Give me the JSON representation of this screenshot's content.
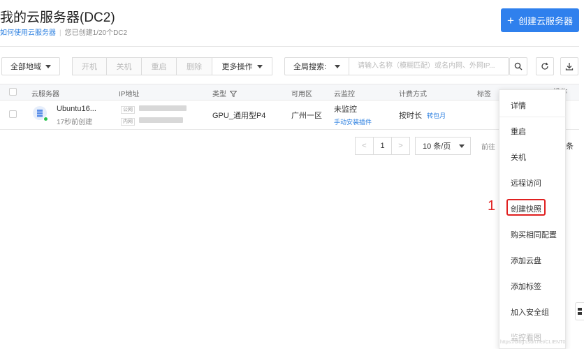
{
  "header": {
    "title": "我的云服务器(DC2)",
    "help_link": "如何使用云服务器",
    "quota_text": "您已创建1/20个DC2",
    "create_button": "创建云服务器"
  },
  "toolbar": {
    "region": "全部地域",
    "actions": [
      "开机",
      "关机",
      "重启",
      "删除"
    ],
    "more": "更多操作",
    "search_scope": "全局搜索:",
    "search_placeholder": "请输入名称（模糊匹配）或名内网、外网IP..."
  },
  "table": {
    "columns": [
      "云服务器",
      "IP地址",
      "类型",
      "可用区",
      "云监控",
      "计费方式",
      "标签",
      "操作"
    ],
    "row": {
      "name": "Ubuntu16...",
      "created": "17秒前创建",
      "ip_public_tag": "公网",
      "ip_private_tag": "内网",
      "type": "GPU_通用型P4",
      "zone": "广州一区",
      "monitor": "未监控",
      "monitor_link": "手动安装插件",
      "billing": "按时长",
      "billing_link": "转包月"
    }
  },
  "pagination": {
    "prev": "<",
    "page": "1",
    "next": ">",
    "page_size": "10 条/页",
    "goto": "前往",
    "suffix": "条"
  },
  "menu": {
    "items": [
      "详情",
      "重启",
      "关机",
      "远程访问",
      "创建快照",
      "购买相同配置",
      "添加云盘",
      "添加标签",
      "加入安全组",
      "监控看图"
    ]
  },
  "annotation": {
    "number": "1"
  },
  "watermark": "https://blog.csdn.net/CLIENT0"
}
